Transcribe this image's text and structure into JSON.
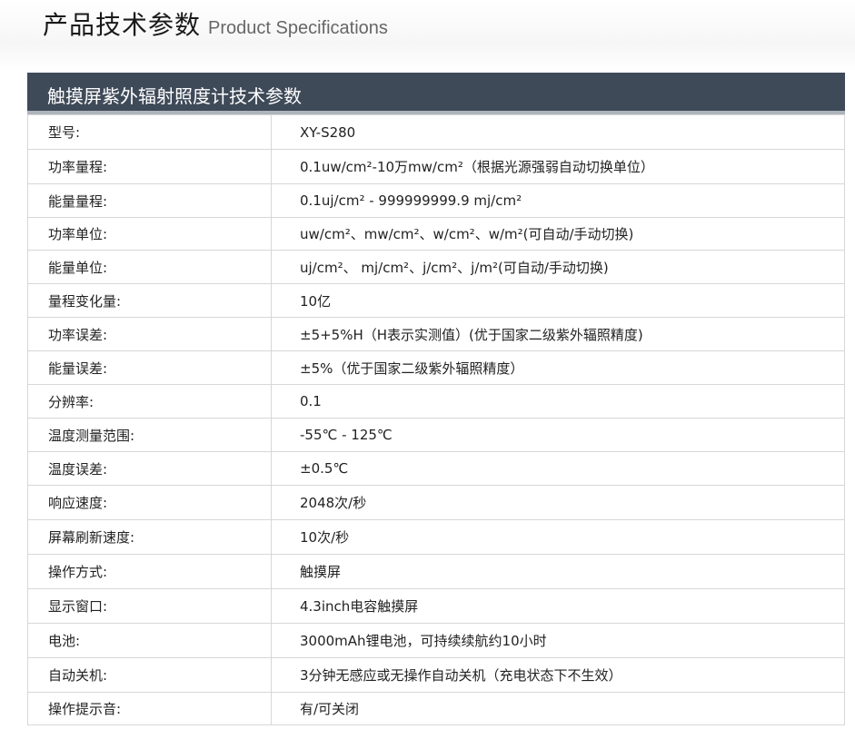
{
  "page": {
    "title_cn": "产品技术参数",
    "title_en": "Product Specifications"
  },
  "table": {
    "heading": "触摸屏紫外辐射照度计技术参数",
    "rows": [
      {
        "label": "型号:",
        "value": "XY-S280"
      },
      {
        "label": "功率量程:",
        "value": "0.1uw/cm²-10万mw/cm²（根据光源强弱自动切换单位）"
      },
      {
        "label": "能量量程:",
        "value": "0.1uj/cm² - 999999999.9 mj/cm²"
      },
      {
        "label": "功率单位:",
        "value": "uw/cm²、mw/cm²、w/cm²、w/m²(可自动/手动切换)"
      },
      {
        "label": "能量单位:",
        "value": "uj/cm²、 mj/cm²、j/cm²、j/m²(可自动/手动切换)"
      },
      {
        "label": "量程变化量:",
        "value": "10亿"
      },
      {
        "label": "功率误差:",
        "value": "±5+5%H（H表示实测值）(优于国家二级紫外辐照精度)"
      },
      {
        "label": "能量误差:",
        "value": "±5%（优于国家二级紫外辐照精度）"
      },
      {
        "label": "分辨率:",
        "value": "0.1"
      },
      {
        "label": "温度测量范围:",
        "value": "-55℃ - 125℃"
      },
      {
        "label": "温度误差:",
        "value": "±0.5℃"
      },
      {
        "label": "响应速度:",
        "value": "2048次/秒"
      },
      {
        "label": "屏幕刷新速度:",
        "value": "10次/秒"
      },
      {
        "label": "操作方式:",
        "value": "触摸屏"
      },
      {
        "label": "显示窗口:",
        "value": "4.3inch电容触摸屏"
      },
      {
        "label": "电池:",
        "value": "3000mAh锂电池，可持续续航约10小时"
      },
      {
        "label": "自动关机:",
        "value": "3分钟无感应或无操作自动关机（充电状态下不生效）"
      },
      {
        "label": "操作提示音:",
        "value": "有/可关闭"
      }
    ]
  }
}
